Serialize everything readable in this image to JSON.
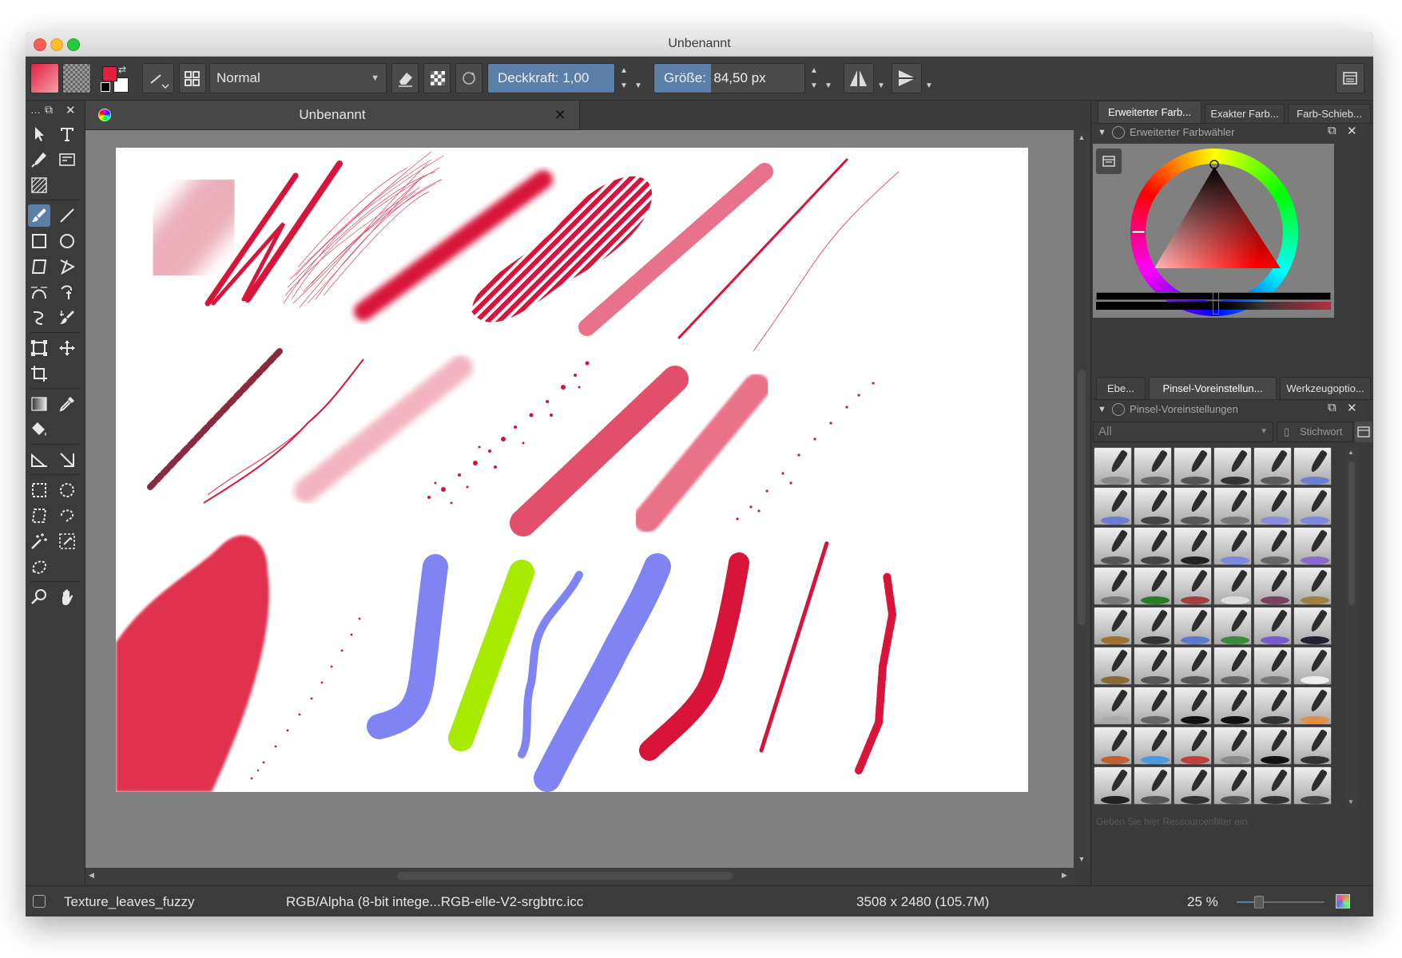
{
  "window": {
    "title": "Unbenannt"
  },
  "toolbar": {
    "blend_mode": "Normal",
    "opacity_label": "Deckkraft:",
    "opacity_value": "1,00",
    "opacity_fraction": 1.0,
    "size_label": "Größe:",
    "size_value": "84,50 px",
    "fg_color": "#e0203e",
    "bg_color": "#ffffff"
  },
  "document": {
    "tab_title": "Unbenannt"
  },
  "dock_top": {
    "tabs": [
      "Erweiterter Farb...",
      "Exakter Farb...",
      "Farb-Schieb..."
    ],
    "panel_title": "Erweiterter Farbwähler"
  },
  "dock_bottom": {
    "tabs": [
      "Ebe...",
      "Pinsel-Voreinstellun...",
      "Werkzeugoptio..."
    ],
    "panel_title": "Pinsel-Voreinstellungen",
    "filter_value": "All",
    "tag_label": "Stichwort",
    "resource_filter_placeholder": "Geben Sie hier Ressourcenfilter ein"
  },
  "statusbar": {
    "brush_name": "Texture_leaves_fuzzy",
    "color_profile": "RGB/Alpha (8-bit intege...RGB-elle-V2-srgbtrc.icc",
    "image_size": "3508 x 2480 (105.7M)",
    "zoom": "25 %"
  },
  "colors": {
    "accent": "#5b7fa8",
    "stroke_red": "#d8143a",
    "stroke_blue": "#7f84f2",
    "stroke_green": "#a8ea00"
  }
}
